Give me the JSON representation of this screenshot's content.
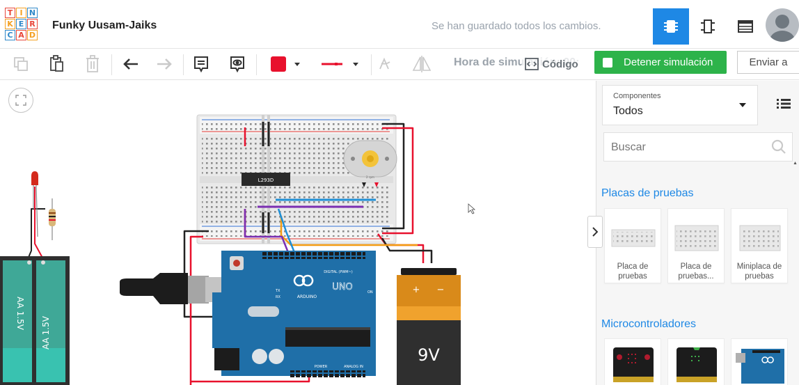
{
  "header": {
    "logo_letters": [
      "T",
      "I",
      "N",
      "K",
      "E",
      "R",
      "C",
      "A",
      "D"
    ],
    "project_name": "Funky Uusam-Jaiks",
    "save_status": "Se han guardado todos los cambios.",
    "view_buttons": [
      "circuit-view-icon",
      "schematic-view-icon",
      "component-list-icon"
    ],
    "accent_color": "#1e88e5"
  },
  "toolbar": {
    "sim_time": "Hora de simulación: 00:",
    "code_label": "Código",
    "stop_label": "Detener simulación",
    "send_label": "Enviar a",
    "stop_color": "#2db34a",
    "wire_color": "#e8112d"
  },
  "canvas": {
    "chip_label": "L293D",
    "board_label": "UNO",
    "board_brand": "ARDUINO",
    "digital_label": "DIGITAL (PWM~)",
    "power_label": "POWER",
    "analog_label": "ANALOG IN",
    "on_label": "ON",
    "tx_label": "TX",
    "rx_label": "RX",
    "battery_label": "9V",
    "battery_plus": "+",
    "battery_minus": "−",
    "aa_label_1": "AA 1.5V",
    "aa_label_2": "AA 1.5V",
    "motor_label": "2 rpm"
  },
  "panel": {
    "components_label": "Componentes",
    "components_value": "Todos",
    "search_placeholder": "Buscar",
    "section_breadboards": "Placas de pruebas",
    "breadboards": [
      {
        "line1": "Placa de",
        "line2": "pruebas"
      },
      {
        "line1": "Placa de",
        "line2": "pruebas..."
      },
      {
        "line1": "Miniplaca de",
        "line2": "pruebas"
      }
    ],
    "section_micro": "Microcontroladores"
  }
}
